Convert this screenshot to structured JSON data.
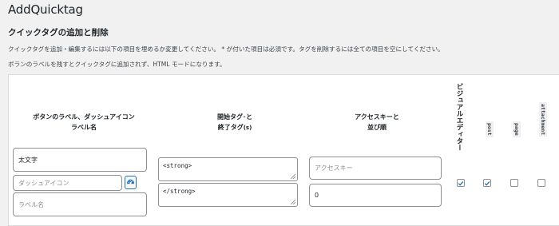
{
  "page": {
    "title": "AddQuicktag",
    "section_title": "クイックタグの追加と削除",
    "description_1": "クイックタグを追加・編集するには以下の項目を埋めるか変更してください。 * が付いた項目は必須です。タグを削除するには全ての項目を空にしてください。",
    "description_2": "ボランのラベルを残すとクイックタグに追加されず、HTML モードになります。"
  },
  "table": {
    "headers": {
      "button_label_line1": "ボタンのラベル、ダッシュアイコン",
      "button_label_line2": "ラベル名",
      "tags_line1": "開始タグ･と",
      "tags_line2": "終了タグ",
      "tags_suffix": "(s)",
      "access_line1": "アクセスキーと",
      "access_line2": "並び順",
      "visual_editor": "ビジュアルエディター",
      "post": "post",
      "page": "page",
      "attachment": "attachment"
    },
    "row": {
      "button_label": "太文字",
      "dashicon_placeholder": "ダッシュアイコン",
      "label_name_placeholder": "ラベル名",
      "start_tag": "<strong>",
      "end_tag": "</strong>",
      "access_key_placeholder": "アクセスキー",
      "order": "0",
      "visual_checked": true,
      "post_checked": true,
      "page_checked": false,
      "attachment_checked": false
    }
  },
  "colors": {
    "accent": "#2271b1",
    "background": "#f1f1f1",
    "panel": "#ffffff"
  },
  "icons": {
    "dashicon_picker": "dashboard-gauge-icon",
    "checkmark": "check-icon"
  }
}
